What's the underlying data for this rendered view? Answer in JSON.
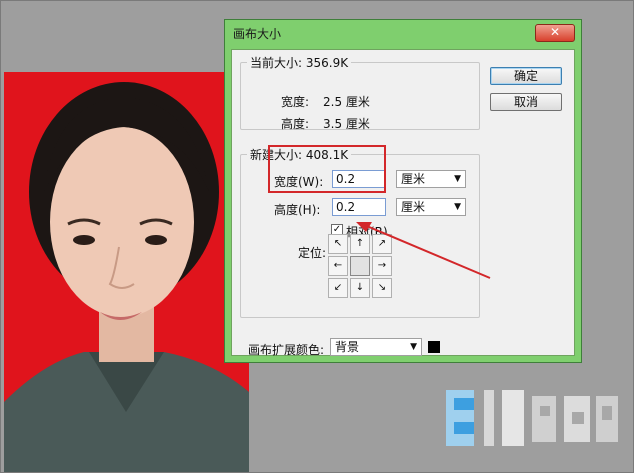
{
  "dialog": {
    "title": "画布大小",
    "close_label": "✕"
  },
  "current_size": {
    "legend": "当前大小: 356.9K",
    "width_label": "宽度:",
    "width_value": "2.5 厘米",
    "height_label": "高度:",
    "height_value": "3.5 厘米"
  },
  "new_size": {
    "legend": "新建大小: 408.1K",
    "width_label": "宽度(W):",
    "width_value": "0.2",
    "width_unit": "厘米",
    "height_label": "高度(H):",
    "height_value": "0.2",
    "height_unit": "厘米",
    "relative_label": "相对(R)",
    "relative_checked": "✓",
    "anchor_label": "定位:"
  },
  "buttons": {
    "ok_label": "确定",
    "cancel_label": "取消"
  },
  "extension": {
    "label": "画布扩展颜色:",
    "value": "背景",
    "swatch_color": "#000000"
  },
  "colors": {
    "title_bar": "#7fcf6e",
    "annotation": "#d3272a",
    "photo_background": "#e0141c"
  },
  "icons": {
    "anchor": [
      "arrow-up-left",
      "arrow-up",
      "arrow-up-right",
      "arrow-left",
      "center",
      "arrow-right",
      "arrow-down-left",
      "arrow-down",
      "arrow-down-right"
    ],
    "anchor_glyphs": [
      "↖",
      "↑",
      "↗",
      "←",
      "",
      "→",
      "↙",
      "↓",
      "↘"
    ]
  }
}
